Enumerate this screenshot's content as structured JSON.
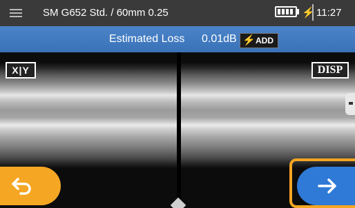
{
  "status_bar": {
    "fiber_setting": "SM G652 Std. / 60mm 0.25",
    "time": "11:27",
    "battery_icon": "battery-full-icon",
    "charge_icon": "lightning-charge-icon"
  },
  "loss": {
    "label": "Estimated Loss",
    "value": "0.01dB",
    "add_label": "ADD"
  },
  "controls": {
    "xy_label": "X|Y",
    "disp_label": "DISP"
  },
  "colors": {
    "banner_blue": "#3f78bf",
    "accent_orange": "#f5a623",
    "next_blue": "#2f7ad6",
    "bolt_yellow": "#f5d400"
  }
}
